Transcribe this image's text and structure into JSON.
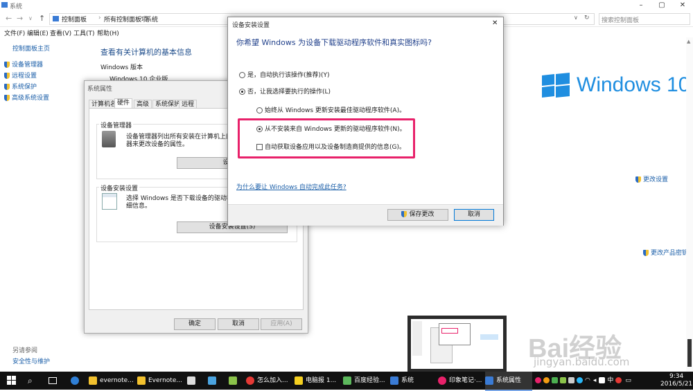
{
  "window": {
    "title": "系统",
    "minimize": "–",
    "maximize": "▢",
    "close": "✕"
  },
  "nav": {
    "back": "←",
    "forward": "→",
    "recent": "∨",
    "up": "↑",
    "path": [
      "控制面板",
      "所有控制面板项",
      "系统"
    ],
    "dropdown": "∨",
    "refresh": "↻",
    "search_placeholder": "搜索控制面板"
  },
  "menu": [
    "文件(F)",
    "编辑(E)",
    "查看(V)",
    "工具(T)",
    "帮助(H)"
  ],
  "sidebar": {
    "home": "控制面板主页",
    "items": [
      "设备管理器",
      "远程设置",
      "系统保护",
      "高级系统设置"
    ],
    "see_also_title": "另请参阅",
    "see_also": [
      "安全性与维护"
    ]
  },
  "main": {
    "heading": "查看有关计算机的基本信息",
    "edition_label": "Windows 版本",
    "edition": "Windows 10 企业版",
    "logo_text": "Windows 10",
    "change_settings": "更改设置",
    "change_key": "更改产品密钥"
  },
  "sysprop": {
    "title": "系统属性",
    "tabs": [
      "计算机名",
      "硬件",
      "高级",
      "系统保护",
      "远程"
    ],
    "dm_group": "设备管理器",
    "dm_text_1": "设备管理器列出所有安装在计算机上的硬件",
    "dm_text_2": "器来更改设备的属性。",
    "dm_button": "设备管",
    "dis_group": "设备安装设置",
    "dis_text_1": "选择 Windows 是否下载设备的驱动程序",
    "dis_text_2": "细信息。",
    "dis_button": "设备安装设置(S)",
    "ok": "确定",
    "cancel": "取消",
    "apply": "应用(A)"
  },
  "dialog": {
    "title": "设备安装设置",
    "close": "✕",
    "question": "你希望 Windows 为设备下载驱动程序软件和真实图标吗?",
    "opt_yes": "是，自动执行该操作(推荐)(Y)",
    "opt_no": "否，让我选择要执行的操作(L)",
    "sub_always": "始终从 Windows 更新安装最佳驱动程序软件(A)。",
    "sub_never": "从不安装来自 Windows 更新的驱动程序软件(N)。",
    "sub_chk": "自动获取设备应用以及设备制造商提供的信息(G)。",
    "link": "为什么要让 Windows 自动完成此任务?",
    "save": "保存更改",
    "cancel": "取消"
  },
  "taskbar": {
    "items": [
      "evernote...",
      "Evernote...",
      "怎么加入...",
      "电脑报 1...",
      "百度经验...",
      "系统",
      "印象笔记·...",
      "系统属性"
    ],
    "tray_lang": "中",
    "time": "9:34",
    "date": "2016/5/21"
  },
  "watermark": {
    "main": "Bai经验",
    "sub": "jingyan.baidu.com"
  },
  "colors": {
    "accent": "#1f8ee0",
    "highlight": "#e8216a",
    "link": "#1a5ea8"
  }
}
